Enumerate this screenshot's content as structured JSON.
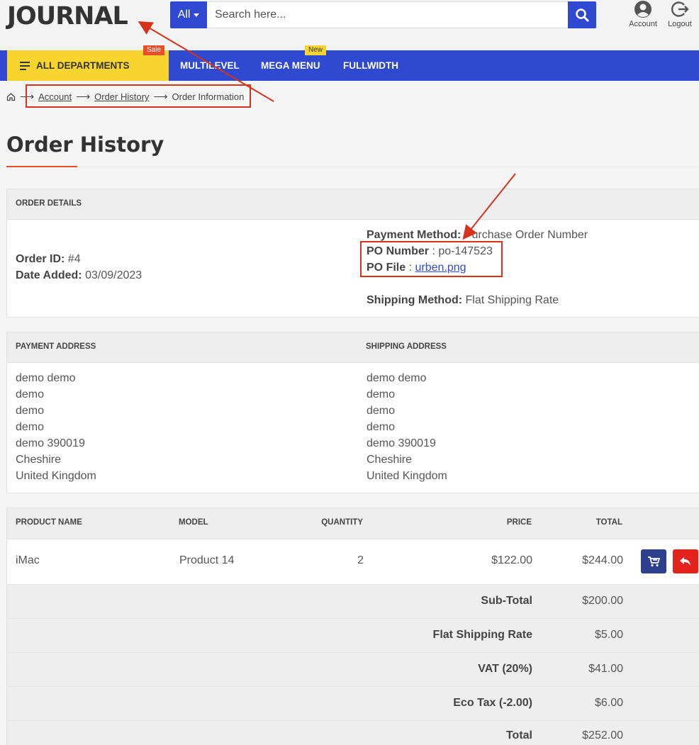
{
  "header": {
    "logo": "JOURNAL",
    "search": {
      "category": "All",
      "placeholder": "Search here..."
    },
    "account_label": "Account",
    "logout_label": "Logout"
  },
  "nav": {
    "departments": "ALL DEPARTMENTS",
    "sale_badge": "Sale",
    "new_badge": "New",
    "items": [
      "MULTILEVEL",
      "MEGA MENU",
      "FULLWIDTH"
    ]
  },
  "breadcrumb": {
    "sep": "⟶",
    "items": [
      "Account",
      "Order History",
      "Order Information"
    ]
  },
  "page_title": "Order History",
  "order_details": {
    "heading": "ORDER DETAILS",
    "order_id_label": "Order ID:",
    "order_id": "#4",
    "date_added_label": "Date Added:",
    "date_added": "03/09/2023",
    "payment_method_label": "Payment Method:",
    "payment_method": "Purchase Order Number",
    "po_number_label": "PO Number",
    "po_number": ": po-147523",
    "po_file_label": "PO File",
    "po_file_sep": ":",
    "po_file": "urben.png",
    "shipping_method_label": "Shipping Method:",
    "shipping_method": "Flat Shipping Rate"
  },
  "addresses": {
    "payment_heading": "PAYMENT ADDRESS",
    "shipping_heading": "SHIPPING ADDRESS",
    "payment": [
      "demo demo",
      "demo",
      "demo",
      "demo",
      "demo 390019",
      "Cheshire",
      "United Kingdom"
    ],
    "shipping": [
      "demo demo",
      "demo",
      "demo",
      "demo",
      "demo 390019",
      "Cheshire",
      "United Kingdom"
    ]
  },
  "products": {
    "headers": {
      "name": "PRODUCT NAME",
      "model": "MODEL",
      "quantity": "QUANTITY",
      "price": "PRICE",
      "total": "TOTAL"
    },
    "rows": [
      {
        "name": "iMac",
        "model": "Product 14",
        "quantity": "2",
        "price": "$122.00",
        "total": "$244.00"
      }
    ],
    "totals": [
      {
        "label": "Sub-Total",
        "value": "$200.00"
      },
      {
        "label": "Flat Shipping Rate",
        "value": "$5.00"
      },
      {
        "label": "VAT (20%)",
        "value": "$41.00"
      },
      {
        "label": "Eco Tax (-2.00)",
        "value": "$6.00"
      },
      {
        "label": "Total",
        "value": "$252.00"
      }
    ]
  },
  "colors": {
    "primary": "#2f49d1",
    "yellow": "#f8d42e",
    "sale": "#e84e29",
    "reorder_button": "#2c3f8f",
    "return_button": "#e4231e",
    "annotation": "#d6331a"
  }
}
